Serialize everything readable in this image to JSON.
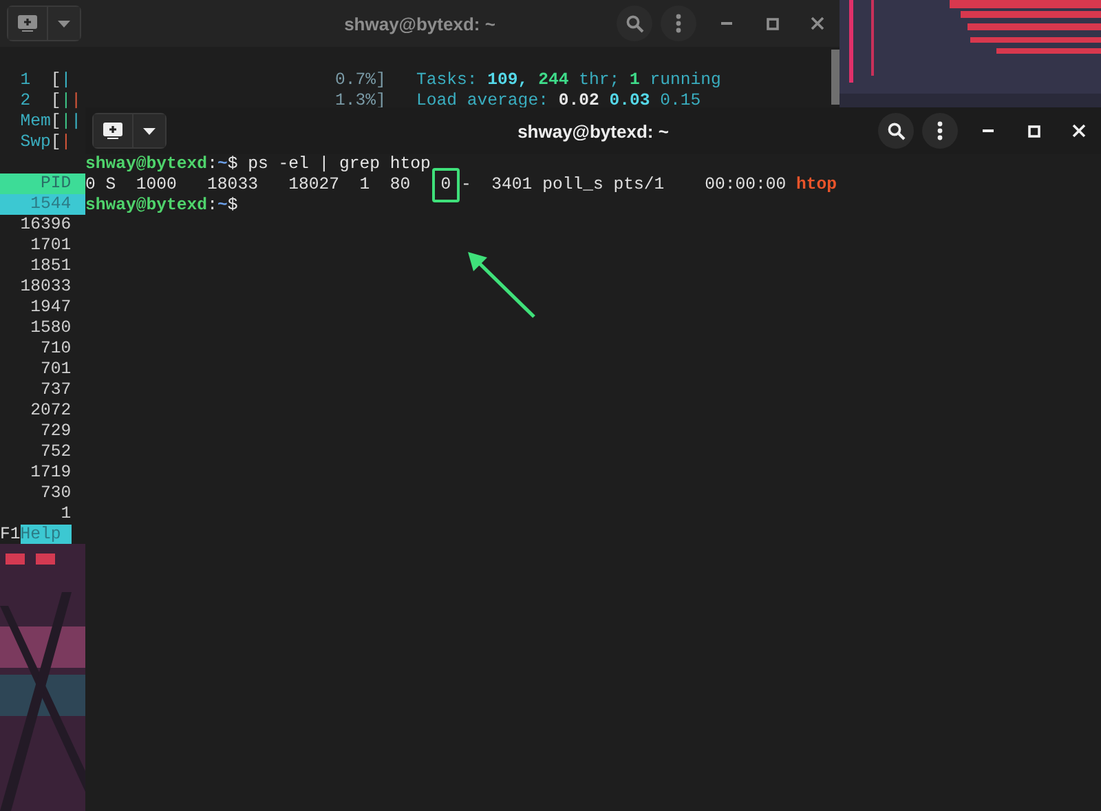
{
  "back_terminal": {
    "title": "shway@bytexd: ~",
    "active": false,
    "meters": [
      {
        "left": [
          {
            "text": "1",
            "kind": "label"
          },
          {
            "text": "[",
            "kind": "bracket"
          },
          {
            "text": "|",
            "kind": "bar",
            "color": "#3ab7c9"
          }
        ],
        "reading": "0.7%]",
        "info": [
          {
            "text": "Tasks:",
            "kind": "label"
          },
          {
            "text": "109,",
            "kind": "value"
          },
          {
            "text": "244",
            "kind": "accent"
          },
          {
            "text": "thr;",
            "kind": "label"
          },
          {
            "text": "1",
            "kind": "accent"
          },
          {
            "text": "running",
            "kind": "label"
          }
        ]
      },
      {
        "left": [
          {
            "text": "2",
            "kind": "label"
          },
          {
            "text": "[",
            "kind": "bracket"
          },
          {
            "text": "|",
            "kind": "bar",
            "color": "#3fc98a"
          },
          {
            "text": "|",
            "kind": "bar",
            "color": "#d9573a"
          }
        ],
        "reading": "1.3%]",
        "info": [
          {
            "text": "Load average:",
            "kind": "label"
          },
          {
            "text": "0.02",
            "kind": "strong"
          },
          {
            "text": "0.03",
            "kind": "value"
          },
          {
            "text": "0.15",
            "kind": "label"
          }
        ]
      },
      {
        "left": [
          {
            "text": "Mem",
            "kind": "label"
          },
          {
            "text": "[",
            "kind": "bracket"
          },
          {
            "text": "|",
            "kind": "bar",
            "color": "#3fc98a"
          },
          {
            "text": "|",
            "kind": "bar",
            "color": "#3ab7c9"
          }
        ]
      },
      {
        "left": [
          {
            "text": "Swp",
            "kind": "label"
          },
          {
            "text": "[",
            "kind": "bracket"
          },
          {
            "text": "|",
            "kind": "bar",
            "color": "#d9573a"
          }
        ]
      }
    ],
    "process_header": "PID",
    "processes": [
      {
        "pid": "1544",
        "selected": true
      },
      {
        "pid": "16396",
        "selected": false
      },
      {
        "pid": "1701",
        "selected": false
      },
      {
        "pid": "1851",
        "selected": false
      },
      {
        "pid": "18033",
        "selected": false
      },
      {
        "pid": "1947",
        "selected": false
      },
      {
        "pid": "1580",
        "selected": false
      },
      {
        "pid": "710",
        "selected": false
      },
      {
        "pid": "701",
        "selected": false
      },
      {
        "pid": "737",
        "selected": false
      },
      {
        "pid": "2072",
        "selected": false
      },
      {
        "pid": "729",
        "selected": false
      },
      {
        "pid": "752",
        "selected": false
      },
      {
        "pid": "1719",
        "selected": false
      },
      {
        "pid": "730",
        "selected": false
      },
      {
        "pid": "1",
        "selected": false
      }
    ],
    "function_keys": [
      {
        "key": "F1",
        "label": "Help"
      }
    ]
  },
  "front_terminal": {
    "title": "shway@bytexd: ~",
    "active": true,
    "lines": [
      {
        "segments": [
          {
            "text": "shway@bytexd",
            "kind": "user"
          },
          {
            "text": ":",
            "kind": "sep"
          },
          {
            "text": "~",
            "kind": "path"
          },
          {
            "text": "$",
            "kind": "prompt"
          },
          {
            "text": "ps -el | grep htop",
            "kind": "command"
          }
        ]
      },
      {
        "segments": [
          {
            "text": "0 S  1000   18033   18027  1  80",
            "kind": "plain"
          },
          {
            "text": "0",
            "kind": "boxed"
          },
          {
            "text": "-  3401 poll_s pts/1    00:00:00",
            "kind": "plain"
          },
          {
            "text": "htop",
            "kind": "highlight"
          }
        ]
      },
      {
        "segments": [
          {
            "text": "shway@bytexd",
            "kind": "user"
          },
          {
            "text": ":",
            "kind": "sep"
          },
          {
            "text": "~",
            "kind": "path"
          },
          {
            "text": "$",
            "kind": "prompt"
          }
        ]
      }
    ]
  }
}
